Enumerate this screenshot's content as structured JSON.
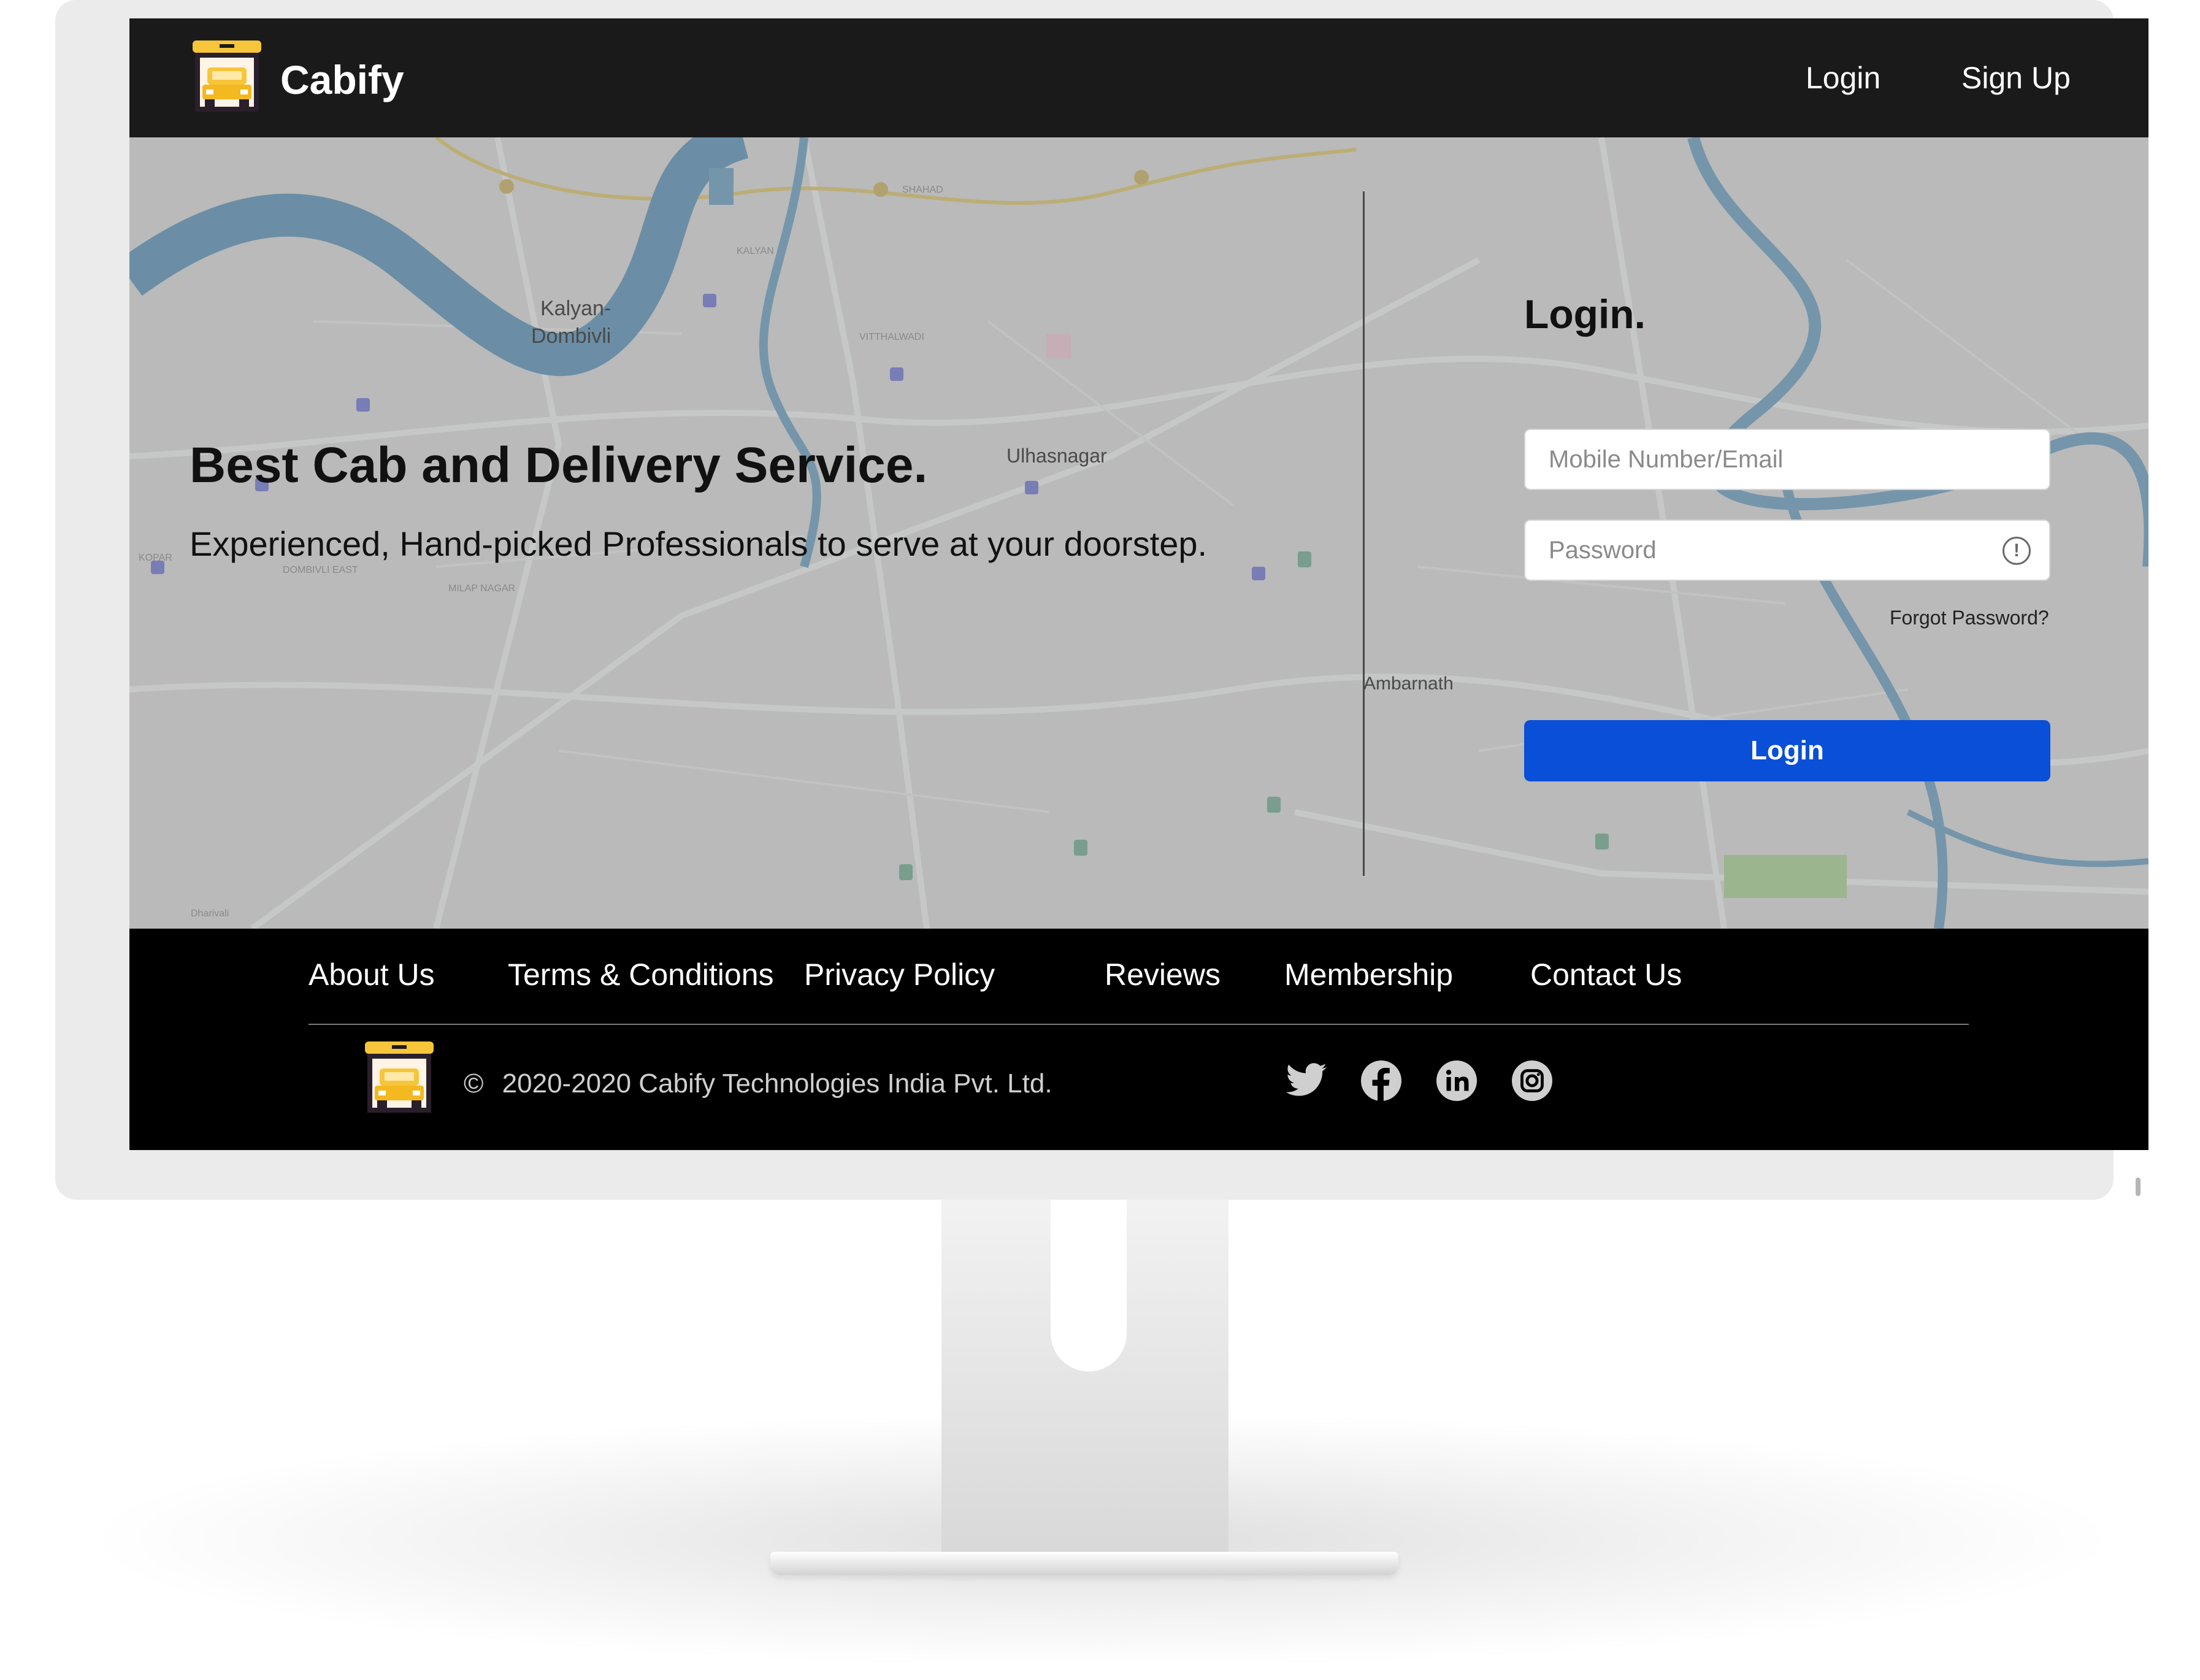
{
  "app": {
    "brand": "Cabify",
    "logo_icon": "taxi-icon",
    "accent_color": "#0a4fd8"
  },
  "header": {
    "nav_login": "Login",
    "nav_signup": "Sign Up"
  },
  "hero": {
    "title": "Best Cab and Delivery Service.",
    "subtitle": "Experienced, Hand-picked Professionals to serve at your doorstep."
  },
  "map": {
    "places": [
      "Kalyan-",
      "Dombivli",
      "Ulhasnagar",
      "Ambarnath",
      "KALYAN",
      "SHAHAD",
      "Dharivali",
      "MILAP NAGAR",
      "DOMBIVLI EAST",
      "KOPAR",
      "VITTHALWADI"
    ]
  },
  "login": {
    "title": "Login.",
    "email_placeholder": "Mobile Number/Email",
    "password_placeholder": "Password",
    "forgot": "Forgot Password?",
    "button": "Login"
  },
  "footer": {
    "links": [
      "About Us",
      "Terms & Conditions",
      "Privacy Policy",
      "Reviews",
      "Membership",
      "Contact Us"
    ],
    "copyright": "2020-2020 Cabify Technologies India Pvt. Ltd.",
    "copyright_symbol": "©",
    "social_icons": [
      "twitter-icon",
      "facebook-icon",
      "linkedin-icon",
      "instagram-icon"
    ]
  }
}
